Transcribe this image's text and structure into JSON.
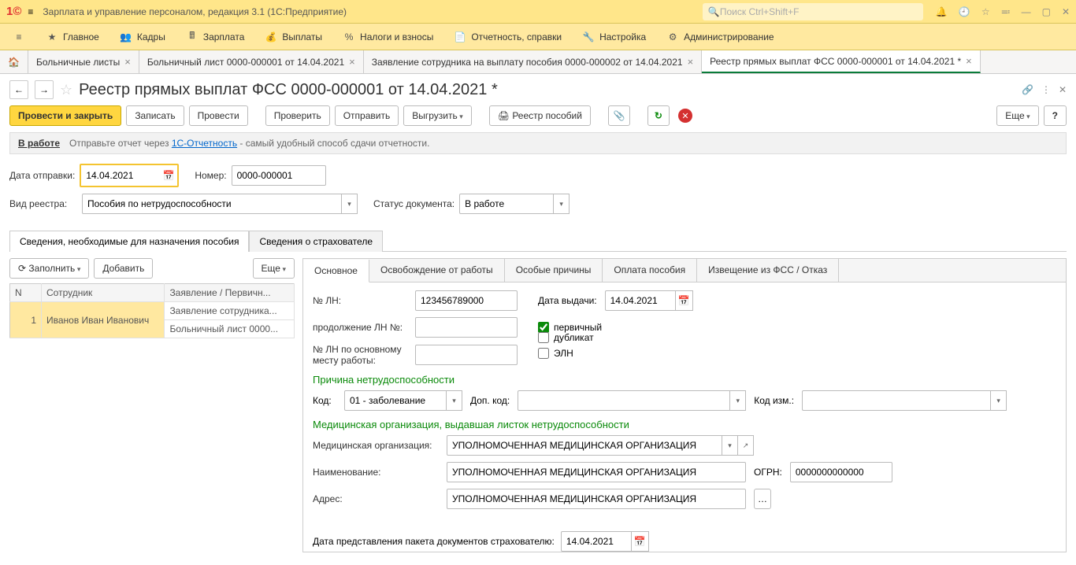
{
  "titlebar": {
    "app_title": "Зарплата и управление персоналом, редакция 3.1  (1С:Предприятие)",
    "search_placeholder": "Поиск Ctrl+Shift+F"
  },
  "menu": {
    "items": [
      {
        "label": "Главное"
      },
      {
        "label": "Кадры"
      },
      {
        "label": "Зарплата"
      },
      {
        "label": "Выплаты"
      },
      {
        "label": "Налоги и взносы"
      },
      {
        "label": "Отчетность, справки"
      },
      {
        "label": "Настройка"
      },
      {
        "label": "Администрирование"
      }
    ]
  },
  "tabs": [
    {
      "label": "Больничные листы"
    },
    {
      "label": "Больничный лист 0000-000001 от 14.04.2021"
    },
    {
      "label": "Заявление сотрудника на выплату пособия 0000-000002 от 14.04.2021"
    },
    {
      "label": "Реестр прямых выплат ФСС 0000-000001 от 14.04.2021 *",
      "active": true
    }
  ],
  "doc": {
    "title": "Реестр прямых выплат ФСС 0000-000001 от 14.04.2021 *"
  },
  "toolbar": {
    "post_close": "Провести и закрыть",
    "save": "Записать",
    "post": "Провести",
    "check": "Проверить",
    "send": "Отправить",
    "upload": "Выгрузить",
    "registry": "Реестр пособий",
    "more": "Еще"
  },
  "status": {
    "label": "В работе",
    "prefix": "Отправьте отчет через ",
    "link": "1С-Отчетность",
    "suffix": " - самый удобный способ сдачи отчетности."
  },
  "form": {
    "date_label": "Дата отправки:",
    "date_value": "14.04.2021",
    "number_label": "Номер:",
    "number_value": "0000-000001",
    "type_label": "Вид реестра:",
    "type_value": "Пособия по нетрудоспособности",
    "doc_status_label": "Статус документа:",
    "doc_status_value": "В работе"
  },
  "inner_tabs": [
    {
      "label": "Сведения, необходимые для назначения пособия",
      "active": true
    },
    {
      "label": "Сведения о страхователе"
    }
  ],
  "left": {
    "fill": "Заполнить",
    "add": "Добавить",
    "more": "Еще",
    "cols": {
      "n": "N",
      "emp": "Сотрудник",
      "app": "Заявление / Первичн..."
    },
    "rows": [
      {
        "n": "1",
        "emp": "Иванов Иван Иванович",
        "app1": "Заявление сотрудника...",
        "app2": "Больничный лист 0000..."
      }
    ]
  },
  "detail_tabs": [
    {
      "label": "Основное",
      "active": true
    },
    {
      "label": "Освобождение от работы"
    },
    {
      "label": "Особые причины"
    },
    {
      "label": "Оплата пособия"
    },
    {
      "label": "Извещение из ФСС / Отказ"
    }
  ],
  "detail": {
    "ln_label": "№ ЛН:",
    "ln_value": "123456789000",
    "issue_date_label": "Дата выдачи:",
    "issue_date_value": "14.04.2021",
    "cont_label": "продолжение ЛН №:",
    "primary": "первичный",
    "duplicate": "дубликат",
    "main_place_label": "№ ЛН по основному месту работы:",
    "eln": "ЭЛН",
    "reason_head": "Причина нетрудоспособности",
    "code_label": "Код:",
    "code_value": "01 - заболевание",
    "addcode_label": "Доп. код:",
    "changecode_label": "Код изм.:",
    "med_head": "Медицинская организация, выдавшая листок нетрудоспособности",
    "med_org_label": "Медицинская организация:",
    "med_org_value": "УПОЛНОМОЧЕННАЯ МЕДИЦИНСКАЯ ОРГАНИЗАЦИЯ",
    "name_label": "Наименование:",
    "name_value": "УПОЛНОМОЧЕННАЯ МЕДИЦИНСКАЯ ОРГАНИЗАЦИЯ",
    "ogrn_label": "ОГРН:",
    "ogrn_value": "0000000000000",
    "addr_label": "Адрес:",
    "addr_value": "УПОЛНОМОЧЕННАЯ МЕДИЦИНСКАЯ ОРГАНИЗАЦИЯ",
    "footer_label": "Дата представления пакета документов страхователю:",
    "footer_value": "14.04.2021"
  }
}
